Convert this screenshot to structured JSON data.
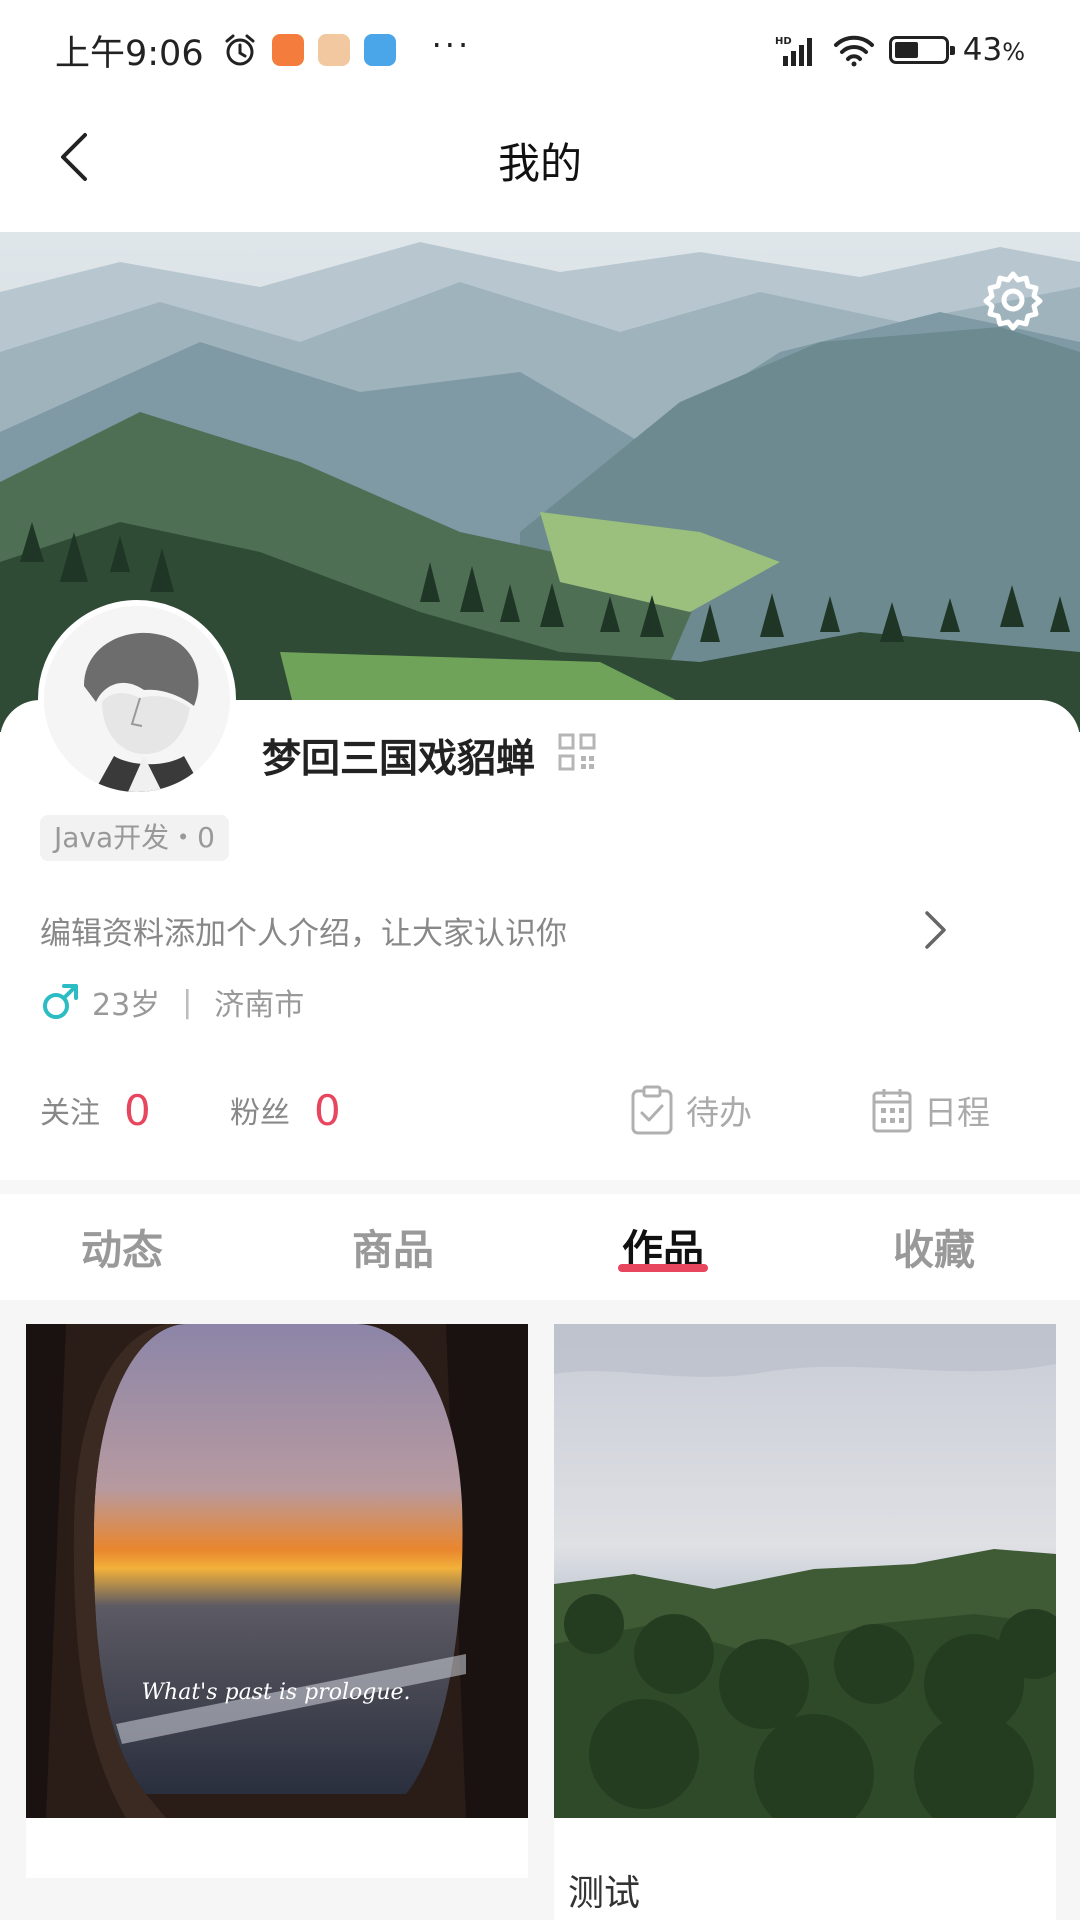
{
  "status_bar": {
    "time": "上午9:06",
    "more": "···",
    "battery": "43",
    "battery_unit": "%",
    "battery_level": 0.43
  },
  "header": {
    "title": "我的"
  },
  "profile": {
    "username": "梦回三国戏貂蝉",
    "tag": "Java开发・0",
    "intro": "编辑资料添加个人介绍，让大家认识你",
    "age": "23岁",
    "separator": "|",
    "city": "济南市"
  },
  "stats": {
    "following_label": "关注",
    "following_count": "0",
    "followers_label": "粉丝",
    "followers_count": "0",
    "todo_label": "待办",
    "schedule_label": "日程"
  },
  "tabs": [
    {
      "label": "动态",
      "active": false
    },
    {
      "label": "商品",
      "active": false
    },
    {
      "label": "作品",
      "active": true
    },
    {
      "label": "收藏",
      "active": false
    }
  ],
  "works": [
    {
      "image_caption": "What's past is prologue.",
      "title": ""
    },
    {
      "image_caption": "",
      "title": "测试"
    }
  ],
  "colors": {
    "accent": "#e8455f",
    "male_icon": "#2bbcc4"
  },
  "icons": [
    "back-arrow-icon",
    "gear-icon",
    "qr-code-icon",
    "chevron-right-icon",
    "male-icon",
    "clipboard-check-icon",
    "calendar-icon",
    "alarm-clock-icon",
    "signal-icon",
    "wifi-icon",
    "battery-icon"
  ]
}
